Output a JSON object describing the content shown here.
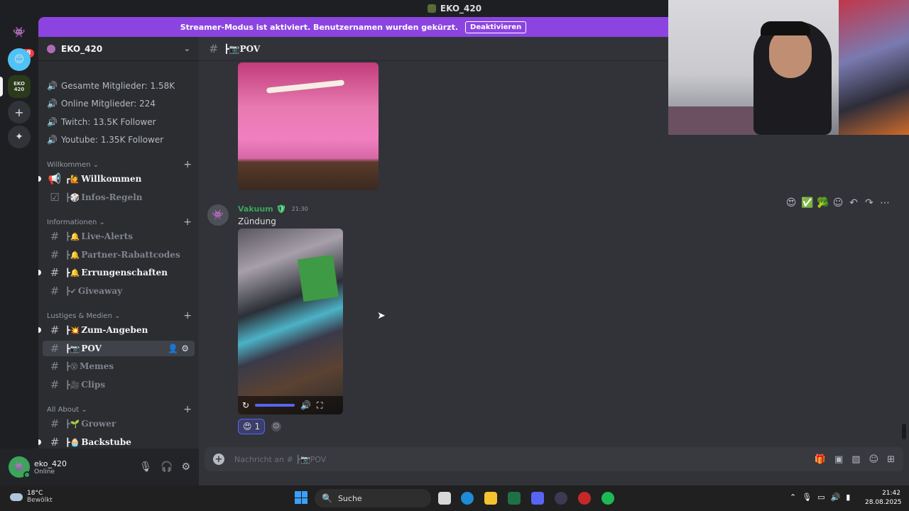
{
  "window": {
    "title": "EKO_420"
  },
  "banner": {
    "text": "Streamer-Modus ist aktiviert. Benutzernamen wurden gekürzt.",
    "button": "Deaktivieren"
  },
  "rail": {
    "dm_badge": "38",
    "server_abbrev": "EKO 420"
  },
  "server": {
    "name": "EKO_420"
  },
  "stats": [
    "Gesamte Mitglieder: 1.58K",
    "Online Mitglieder: 224",
    "Twitch: 13.5K Follower",
    "Youtube: 1.35K Follower"
  ],
  "categories": {
    "willkommen": "Willkommen",
    "informationen": "Informationen",
    "lustiges": "Lustiges & Medien",
    "allabout": "All About"
  },
  "channels": {
    "willkommen": "Willkommen",
    "infos": "Infos-Regeln",
    "livealerts": "Live-Alerts",
    "partner": "Partner-Rabattcodes",
    "errungenschaften": "Errungenschaften",
    "giveaway": "Giveaway",
    "zumangeben": "Zum-Angeben",
    "pov": "POV",
    "memes": "Memes",
    "clips": "Clips",
    "grower": "Grower",
    "backstube": "Backstube"
  },
  "user": {
    "name": "eko_420",
    "status": "Online"
  },
  "chat": {
    "channel_title": "POV",
    "message": {
      "author": "Vakuum",
      "time": "21:30",
      "text": "Zündung"
    },
    "reaction": {
      "emoji": "😍",
      "count": "1"
    },
    "composer_placeholder": "Nachricht an # ┣📷POV"
  },
  "taskbar": {
    "temp": "18°C",
    "weather": "Bewölkt",
    "search": "Suche",
    "time": "21:42",
    "date": "28.08.2025"
  },
  "colors": {
    "banner": "#8c44e0",
    "author": "#3ba55c",
    "accent": "#5865f2"
  }
}
